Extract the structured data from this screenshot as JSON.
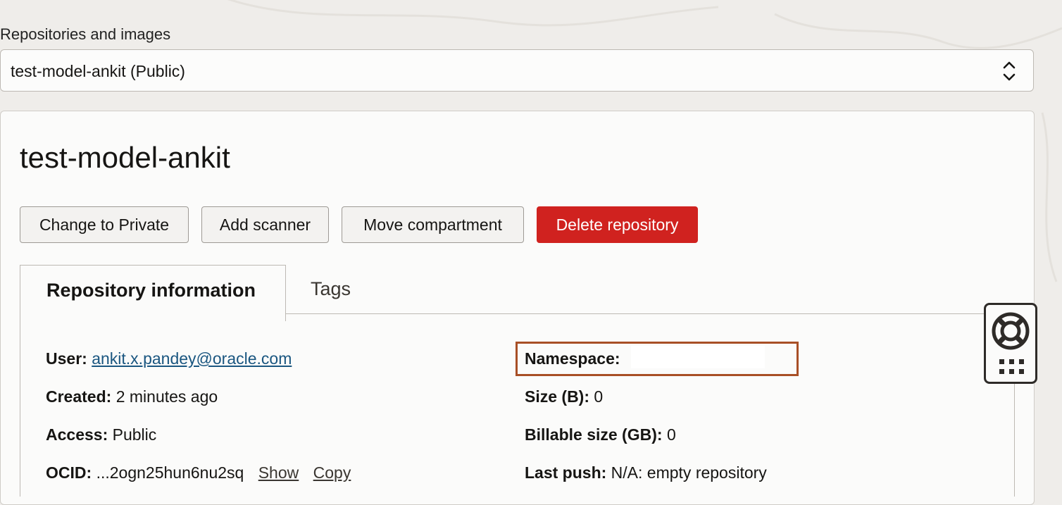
{
  "selector": {
    "label": "Repositories and images",
    "value": "test-model-ankit (Public)",
    "icon": "chevron-up-down-icon"
  },
  "repo": {
    "title": "test-model-ankit",
    "actions": {
      "change_private": "Change to Private",
      "add_scanner": "Add scanner",
      "move_compartment": "Move compartment",
      "delete": "Delete repository"
    },
    "tabs": [
      "Repository information",
      "Tags"
    ],
    "info": {
      "user_label": "User:",
      "user_value": "ankit.x.pandey@oracle.com",
      "created_label": "Created:",
      "created_value": "2 minutes ago",
      "access_label": "Access:",
      "access_value": "Public",
      "ocid_label": "OCID:",
      "ocid_value": "...2ogn25hun6nu2sq",
      "ocid_show": "Show",
      "ocid_copy": "Copy",
      "namespace_label": "Namespace:",
      "size_label": "Size (B):",
      "size_value": "0",
      "billable_label": "Billable size (GB):",
      "billable_value": "0",
      "last_push_label": "Last push:",
      "last_push_value": "N/A: empty repository"
    }
  },
  "colors": {
    "danger": "#d0221f",
    "link": "#1a5680",
    "highlight_border": "#a84f26"
  },
  "help_widget": {
    "icons": [
      "lifebuoy-icon",
      "grid-dots-icon"
    ]
  }
}
